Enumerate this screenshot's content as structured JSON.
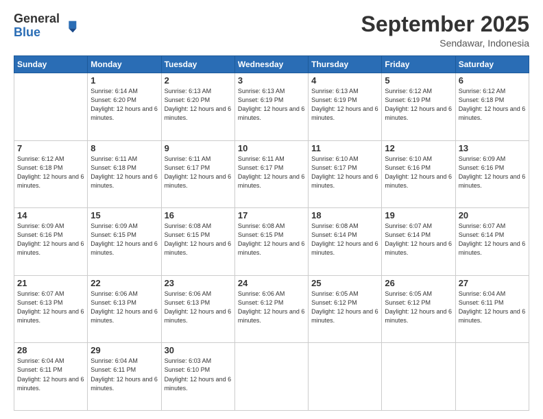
{
  "logo": {
    "general": "General",
    "blue": "Blue"
  },
  "title": "September 2025",
  "location": "Sendawar, Indonesia",
  "days_header": [
    "Sunday",
    "Monday",
    "Tuesday",
    "Wednesday",
    "Thursday",
    "Friday",
    "Saturday"
  ],
  "weeks": [
    [
      {
        "day": "",
        "sunrise": "",
        "sunset": "",
        "daylight": ""
      },
      {
        "day": "1",
        "sunrise": "Sunrise: 6:14 AM",
        "sunset": "Sunset: 6:20 PM",
        "daylight": "Daylight: 12 hours and 6 minutes."
      },
      {
        "day": "2",
        "sunrise": "Sunrise: 6:13 AM",
        "sunset": "Sunset: 6:20 PM",
        "daylight": "Daylight: 12 hours and 6 minutes."
      },
      {
        "day": "3",
        "sunrise": "Sunrise: 6:13 AM",
        "sunset": "Sunset: 6:19 PM",
        "daylight": "Daylight: 12 hours and 6 minutes."
      },
      {
        "day": "4",
        "sunrise": "Sunrise: 6:13 AM",
        "sunset": "Sunset: 6:19 PM",
        "daylight": "Daylight: 12 hours and 6 minutes."
      },
      {
        "day": "5",
        "sunrise": "Sunrise: 6:12 AM",
        "sunset": "Sunset: 6:19 PM",
        "daylight": "Daylight: 12 hours and 6 minutes."
      },
      {
        "day": "6",
        "sunrise": "Sunrise: 6:12 AM",
        "sunset": "Sunset: 6:18 PM",
        "daylight": "Daylight: 12 hours and 6 minutes."
      }
    ],
    [
      {
        "day": "7",
        "sunrise": "Sunrise: 6:12 AM",
        "sunset": "Sunset: 6:18 PM",
        "daylight": "Daylight: 12 hours and 6 minutes."
      },
      {
        "day": "8",
        "sunrise": "Sunrise: 6:11 AM",
        "sunset": "Sunset: 6:18 PM",
        "daylight": "Daylight: 12 hours and 6 minutes."
      },
      {
        "day": "9",
        "sunrise": "Sunrise: 6:11 AM",
        "sunset": "Sunset: 6:17 PM",
        "daylight": "Daylight: 12 hours and 6 minutes."
      },
      {
        "day": "10",
        "sunrise": "Sunrise: 6:11 AM",
        "sunset": "Sunset: 6:17 PM",
        "daylight": "Daylight: 12 hours and 6 minutes."
      },
      {
        "day": "11",
        "sunrise": "Sunrise: 6:10 AM",
        "sunset": "Sunset: 6:17 PM",
        "daylight": "Daylight: 12 hours and 6 minutes."
      },
      {
        "day": "12",
        "sunrise": "Sunrise: 6:10 AM",
        "sunset": "Sunset: 6:16 PM",
        "daylight": "Daylight: 12 hours and 6 minutes."
      },
      {
        "day": "13",
        "sunrise": "Sunrise: 6:09 AM",
        "sunset": "Sunset: 6:16 PM",
        "daylight": "Daylight: 12 hours and 6 minutes."
      }
    ],
    [
      {
        "day": "14",
        "sunrise": "Sunrise: 6:09 AM",
        "sunset": "Sunset: 6:16 PM",
        "daylight": "Daylight: 12 hours and 6 minutes."
      },
      {
        "day": "15",
        "sunrise": "Sunrise: 6:09 AM",
        "sunset": "Sunset: 6:15 PM",
        "daylight": "Daylight: 12 hours and 6 minutes."
      },
      {
        "day": "16",
        "sunrise": "Sunrise: 6:08 AM",
        "sunset": "Sunset: 6:15 PM",
        "daylight": "Daylight: 12 hours and 6 minutes."
      },
      {
        "day": "17",
        "sunrise": "Sunrise: 6:08 AM",
        "sunset": "Sunset: 6:15 PM",
        "daylight": "Daylight: 12 hours and 6 minutes."
      },
      {
        "day": "18",
        "sunrise": "Sunrise: 6:08 AM",
        "sunset": "Sunset: 6:14 PM",
        "daylight": "Daylight: 12 hours and 6 minutes."
      },
      {
        "day": "19",
        "sunrise": "Sunrise: 6:07 AM",
        "sunset": "Sunset: 6:14 PM",
        "daylight": "Daylight: 12 hours and 6 minutes."
      },
      {
        "day": "20",
        "sunrise": "Sunrise: 6:07 AM",
        "sunset": "Sunset: 6:14 PM",
        "daylight": "Daylight: 12 hours and 6 minutes."
      }
    ],
    [
      {
        "day": "21",
        "sunrise": "Sunrise: 6:07 AM",
        "sunset": "Sunset: 6:13 PM",
        "daylight": "Daylight: 12 hours and 6 minutes."
      },
      {
        "day": "22",
        "sunrise": "Sunrise: 6:06 AM",
        "sunset": "Sunset: 6:13 PM",
        "daylight": "Daylight: 12 hours and 6 minutes."
      },
      {
        "day": "23",
        "sunrise": "Sunrise: 6:06 AM",
        "sunset": "Sunset: 6:13 PM",
        "daylight": "Daylight: 12 hours and 6 minutes."
      },
      {
        "day": "24",
        "sunrise": "Sunrise: 6:06 AM",
        "sunset": "Sunset: 6:12 PM",
        "daylight": "Daylight: 12 hours and 6 minutes."
      },
      {
        "day": "25",
        "sunrise": "Sunrise: 6:05 AM",
        "sunset": "Sunset: 6:12 PM",
        "daylight": "Daylight: 12 hours and 6 minutes."
      },
      {
        "day": "26",
        "sunrise": "Sunrise: 6:05 AM",
        "sunset": "Sunset: 6:12 PM",
        "daylight": "Daylight: 12 hours and 6 minutes."
      },
      {
        "day": "27",
        "sunrise": "Sunrise: 6:04 AM",
        "sunset": "Sunset: 6:11 PM",
        "daylight": "Daylight: 12 hours and 6 minutes."
      }
    ],
    [
      {
        "day": "28",
        "sunrise": "Sunrise: 6:04 AM",
        "sunset": "Sunset: 6:11 PM",
        "daylight": "Daylight: 12 hours and 6 minutes."
      },
      {
        "day": "29",
        "sunrise": "Sunrise: 6:04 AM",
        "sunset": "Sunset: 6:11 PM",
        "daylight": "Daylight: 12 hours and 6 minutes."
      },
      {
        "day": "30",
        "sunrise": "Sunrise: 6:03 AM",
        "sunset": "Sunset: 6:10 PM",
        "daylight": "Daylight: 12 hours and 6 minutes."
      },
      {
        "day": "",
        "sunrise": "",
        "sunset": "",
        "daylight": ""
      },
      {
        "day": "",
        "sunrise": "",
        "sunset": "",
        "daylight": ""
      },
      {
        "day": "",
        "sunrise": "",
        "sunset": "",
        "daylight": ""
      },
      {
        "day": "",
        "sunrise": "",
        "sunset": "",
        "daylight": ""
      }
    ]
  ]
}
